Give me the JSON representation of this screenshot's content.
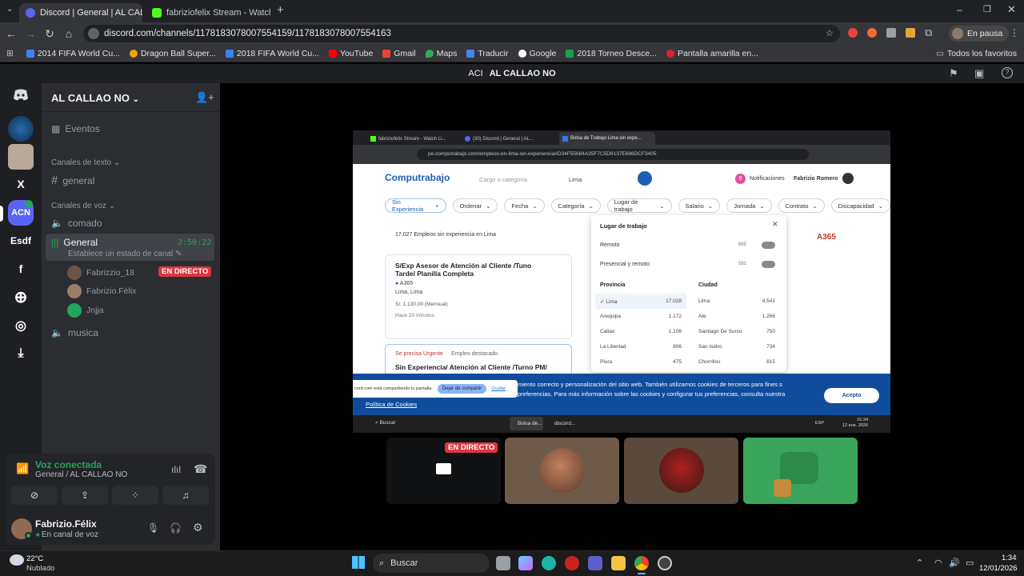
{
  "browser": {
    "tabs": [
      {
        "label": "Discord | General | AL CALL...",
        "active": true
      },
      {
        "label": "fabriziofelix Stream - Watch Liv...",
        "active": false
      }
    ],
    "url": "discord.com/channels/1178183078007554159/1178183078007554163",
    "profile_label": "En pausa",
    "bookmarks": [
      "2014 FIFA World Cu...",
      "Dragon Ball Super...",
      "2018 FIFA World Cu...",
      "YouTube",
      "Gmail",
      "Maps",
      "Traducir",
      "Google",
      "2018 Torneo Desce...",
      "Pantalla amarilla en..."
    ],
    "all_bookmarks": "Todos los favoritos"
  },
  "discord": {
    "title_tag": "ACI",
    "title": "AL CALLAO NO",
    "rail": {
      "server_x": "X",
      "server_acn": "ACN",
      "server_esdf": "Esdf",
      "server_f": "f"
    },
    "server_name": "AL CALLAO NO",
    "events": "Eventos",
    "text_category": "Canales de texto",
    "text_channels": [
      "general"
    ],
    "voice_category": "Canales de voz",
    "voice_channels": [
      "comado",
      "General",
      "musica"
    ],
    "active_voice": {
      "name": "General",
      "timer": "2:50:22",
      "status": "Establece un estado de canal"
    },
    "voice_users": [
      {
        "name": "Fabrizzio_18",
        "badge": "EN DIRECTO"
      },
      {
        "name": "Fabrizio.Félix",
        "badge": ""
      },
      {
        "name": "Jnjja",
        "badge": ""
      }
    ],
    "voice_panel": {
      "title": "Voz conectada",
      "subtitle": "General / AL CALLAO NO"
    },
    "user": {
      "name": "Fabrizio.Félix",
      "status": "En canal de voz"
    },
    "tile_badge": "EN DIRECTO"
  },
  "stream": {
    "tabs": [
      "fabriziofelix Stream - Watch Li...",
      "(30) Discord | General | AL...",
      "Bolsa de Trabajo Lima sin expe..."
    ],
    "url": "pe.computrabajo.com/empleos-en-lima-sin-experiencia#D34F55684A35F7C5D6137E686DCF3405",
    "site": {
      "logo": "Computrabajo",
      "search_placeholder": "Cargo o categoría",
      "location": "Lima",
      "notif_count": "9",
      "notif_label": "Notificaciones",
      "user_name": "Fabrizio Romero",
      "filters": [
        "Sin Experiencia",
        "Ordenar",
        "Fecha",
        "Categoría",
        "Lugar de trabajo",
        "Salario",
        "Jornada",
        "Contrato",
        "Discapacidad"
      ],
      "results_count": "17.027 Empleos sin experiencia en Lima",
      "job1": {
        "title": "S/Exp Asesor de Atención al Cliente /Tuno Tarde/ Planilla Completa",
        "company": "A365",
        "location": "Lima, Lima",
        "salary": "S/. 1.130,00 (Mensual)",
        "age": "Hace 20 minutos"
      },
      "job2": {
        "tag1": "Se precisa Urgente",
        "tag2": "Empleo destacado",
        "title": "Sin Experiencia/ Atención al Cliente /Turno PM/"
      },
      "logo_right": "A365",
      "dropdown": {
        "title": "Lugar de trabajo",
        "options": [
          {
            "label": "Remoto",
            "count": "685"
          },
          {
            "label": "Presencial y remoto",
            "count": "581"
          }
        ],
        "prov_header": "Provincia",
        "city_header": "Ciudad",
        "provinces": [
          {
            "label": "Lima",
            "count": "17.028"
          },
          {
            "label": "Arequipa",
            "count": "1.172"
          },
          {
            "label": "Callao",
            "count": "1.106"
          },
          {
            "label": "La Libertad",
            "count": "806"
          },
          {
            "label": "Piura",
            "count": "475"
          }
        ],
        "cities": [
          {
            "label": "Lima",
            "count": "4.541"
          },
          {
            "label": "Ate",
            "count": "1.266"
          },
          {
            "label": "Santiago De Surco",
            "count": "750"
          },
          {
            "label": "San Isidro",
            "count": "734"
          },
          {
            "label": "Chorrillos",
            "count": "615"
          }
        ]
      }
    },
    "cookie_text": "miento correcto y personalización del sitio web. También utilizamos cookies de terceros para fines s preferencias. Para más información sobre las cookies y configurar tus preferencias, consulta nuestra",
    "cookie_link": "Política de Cookies",
    "cookie_btn": "Acepto",
    "share_text": "cord.com está compartiendo tu pantalla.",
    "share_stop": "Dejar de compartir",
    "share_hide": "Ocultar",
    "taskbar_search": "Buscar",
    "taskbar_apps": [
      "Bolsa de...",
      "discord..."
    ],
    "time": "01:34",
    "date": "12 ene. 2026",
    "lang": "ESP"
  },
  "taskbar": {
    "weather_temp": "22°C",
    "weather_desc": "Nublado",
    "search": "Buscar",
    "time": "1:34",
    "date": "12/01/2026"
  }
}
